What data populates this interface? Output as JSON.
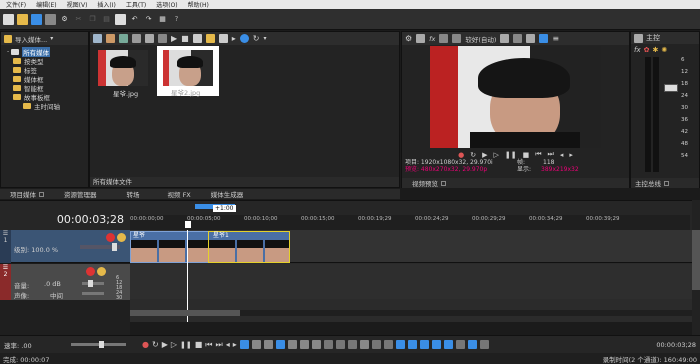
{
  "menu": [
    "文件(F)",
    "编辑(E)",
    "视图(V)",
    "插入(I)",
    "工具(T)",
    "选项(O)",
    "帮助(H)"
  ],
  "tree": {
    "import_label": "导入媒体...",
    "items": [
      {
        "label": "所有媒体",
        "indent": 1,
        "selected": true
      },
      {
        "label": "按类型",
        "indent": 1
      },
      {
        "label": "标签",
        "indent": 1
      },
      {
        "label": "媒体框",
        "indent": 1
      },
      {
        "label": "智能框",
        "indent": 1
      },
      {
        "label": "故事板框",
        "indent": 1
      },
      {
        "label": "主时间轴",
        "indent": 2
      }
    ]
  },
  "media": {
    "files": [
      {
        "name": "星爷.jpg"
      },
      {
        "name": "星爷2.jpg"
      }
    ],
    "footer_label": "所有媒体文件"
  },
  "preview": {
    "quality_label": "较好(自动)",
    "project": "项目: 1920x1080x32, 29.970i",
    "preview": "预览: 480x270x32, 29.970p",
    "frame_label": "帧:",
    "frame_value": "118",
    "display_label": "显示:",
    "display_value": "389x219x32",
    "tab": "视频预览"
  },
  "master": {
    "title": "主控",
    "ticks": [
      "6",
      "12",
      "18",
      "24",
      "30",
      "36",
      "42",
      "48",
      "54"
    ],
    "tab": "主控总线"
  },
  "tabs": [
    {
      "label": "项目媒体"
    },
    {
      "label": "资源管理器"
    },
    {
      "label": "转场"
    },
    {
      "label": "视频 FX"
    },
    {
      "label": "媒体生成器"
    }
  ],
  "timeline": {
    "timecode": "00:00:03;28",
    "marker": "+1:00",
    "ruler": [
      "00:00:00;00",
      "00:00:05;00",
      "00:00:10;00",
      "00:00:15;00",
      "00:00:19;29",
      "00:00:24;29",
      "00:00:29;29",
      "00:00:34;29",
      "00:00:39;29"
    ],
    "track1": {
      "number": "1",
      "level": "级别: 100.0 %"
    },
    "track2": {
      "number": "2",
      "volume_label": "音量:",
      "volume_value": ".0 dB",
      "pan_label": "声像:",
      "pan_value": "中间",
      "meter": [
        "6",
        "12",
        "18",
        "24",
        "30"
      ]
    },
    "clip1": "星爷",
    "clip2": "星爷1"
  },
  "bottom": {
    "rate_label": "速率: .00",
    "timecode": "00:00:03;28"
  },
  "status": {
    "left": "完成: 00:00:07",
    "right": "录制时间(2 个通道): 160:49:00"
  }
}
